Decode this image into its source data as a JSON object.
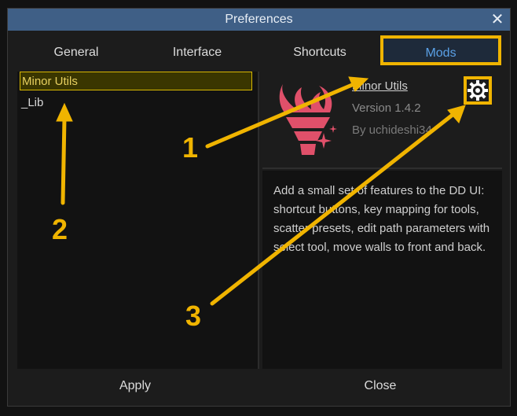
{
  "window": {
    "title": "Preferences"
  },
  "tabs": [
    {
      "label": "General"
    },
    {
      "label": "Interface"
    },
    {
      "label": "Shortcuts"
    },
    {
      "label": "Mods"
    }
  ],
  "mods_list": [
    {
      "label": "Minor Utils",
      "selected": true
    },
    {
      "label": "_Lib",
      "selected": false
    }
  ],
  "mod_detail": {
    "name": "Minor Utils",
    "version": "Version 1.4.2",
    "author": "By uchideshi34",
    "description": "Add a small set of features to the DD UI: shortcut buttons, key mapping for tools, scatter presets, edit path parameters with select tool, move walls to front and back."
  },
  "buttons": {
    "apply": "Apply",
    "close": "Close"
  },
  "annotations": {
    "label_1": "1",
    "label_2": "2",
    "label_3": "3"
  },
  "colors": {
    "titlebar": "#3f5f86",
    "highlight": "#f0b400",
    "selected_text": "#e8d060",
    "active_tab_text": "#5aa0e6",
    "logo": "#e0506a"
  },
  "icons": {
    "close": "close-icon",
    "settings": "gear-icon",
    "logo": "torch-logo-icon"
  }
}
